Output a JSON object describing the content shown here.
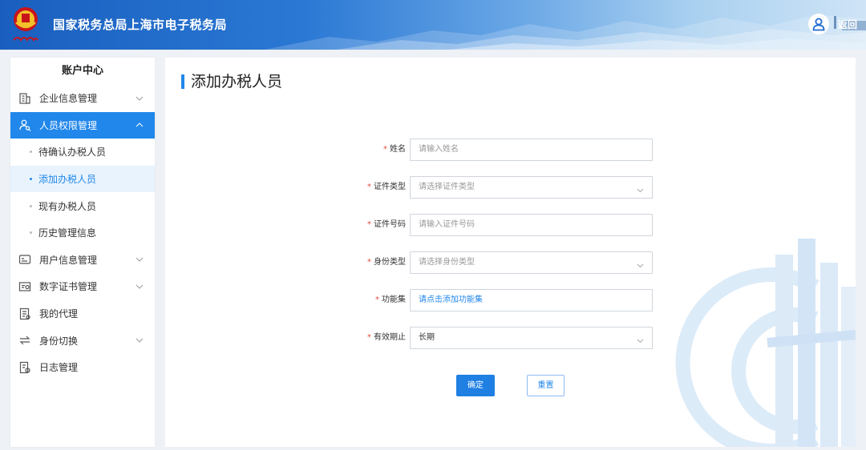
{
  "header": {
    "title": "国家税务总局上海市电子税务局",
    "back_label": "返回",
    "emblem_icon": "tax-emblem-icon",
    "user_icon": "user-avatar-icon",
    "brand_color": "#1a5fbf"
  },
  "sidebar": {
    "title": "账户中心",
    "accent_color": "#2187ea",
    "items": [
      {
        "label": "企业信息管理",
        "icon": "building-icon",
        "expandable": true,
        "expanded": false
      },
      {
        "label": "人员权限管理",
        "icon": "user-search-icon",
        "expandable": true,
        "expanded": true,
        "active": true
      },
      {
        "label": "用户信息管理",
        "icon": "id-card-icon",
        "expandable": true,
        "expanded": false
      },
      {
        "label": "数字证书管理",
        "icon": "certificate-icon",
        "expandable": true,
        "expanded": false
      },
      {
        "label": "我的代理",
        "icon": "document-icon",
        "expandable": false
      },
      {
        "label": "身份切换",
        "icon": "switch-icon",
        "expandable": true,
        "expanded": false
      },
      {
        "label": "日志管理",
        "icon": "log-icon",
        "expandable": false
      }
    ],
    "subitems": [
      {
        "label": "待确认办税人员",
        "current": false
      },
      {
        "label": "添加办税人员",
        "current": true
      },
      {
        "label": "现有办税人员",
        "current": false
      },
      {
        "label": "历史管理信息",
        "current": false
      }
    ]
  },
  "main": {
    "title": "添加办税人员",
    "form": {
      "name": {
        "label": "姓名",
        "placeholder": "请输入姓名"
      },
      "id_type": {
        "label": "证件类型",
        "placeholder": "请选择证件类型"
      },
      "id_number": {
        "label": "证件号码",
        "placeholder": "请输入证件号码"
      },
      "identity_type": {
        "label": "身份类型",
        "placeholder": "请选择身份类型"
      },
      "function_set": {
        "label": "功能集",
        "link_text": "请点击添加功能集"
      },
      "valid_until": {
        "label": "有效期止",
        "value": "长期"
      }
    },
    "confirm_label": "确定",
    "reset_label": "重置"
  }
}
